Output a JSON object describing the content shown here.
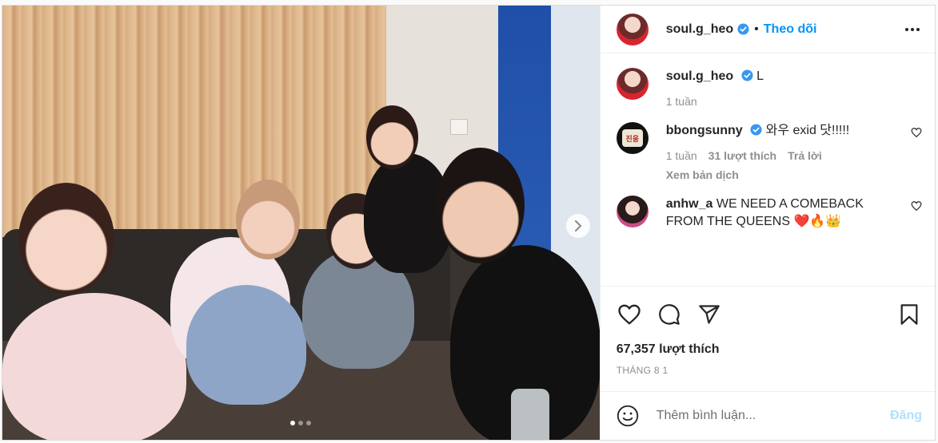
{
  "header": {
    "username": "soul.g_heo",
    "separator": "•",
    "follow_label": "Theo dõi",
    "more_icon": "more-horizontal-icon"
  },
  "caption": {
    "username": "soul.g_heo",
    "text": "L",
    "time": "1 tuần"
  },
  "comments": [
    {
      "username": "bbongsunny",
      "verified": true,
      "text": "와우 exid 닷!!!!!",
      "time": "1 tuần",
      "likes": "31 lượt thích",
      "reply_label": "Trả lời",
      "translate_label": "Xem bản dịch",
      "avatar_text": "진웅"
    },
    {
      "username": "anhw_a",
      "verified": false,
      "text": "WE NEED A COMEBACK FROM THE QUEENS ❤️🔥👑"
    }
  ],
  "actions": {
    "icons": [
      "heart-icon",
      "comment-icon",
      "share-icon",
      "bookmark-icon"
    ]
  },
  "likes_text": "67,357 lượt thích",
  "date_text": "THÁNG 8 1",
  "add_comment": {
    "placeholder": "Thêm bình luận...",
    "post_label": "Đăng"
  },
  "carousel": {
    "total": 3,
    "current": 1
  },
  "colors": {
    "accent": "#0095f6",
    "verified": "#3897f0",
    "muted": "#8e8e8e",
    "post_disabled": "#b2dffc"
  }
}
